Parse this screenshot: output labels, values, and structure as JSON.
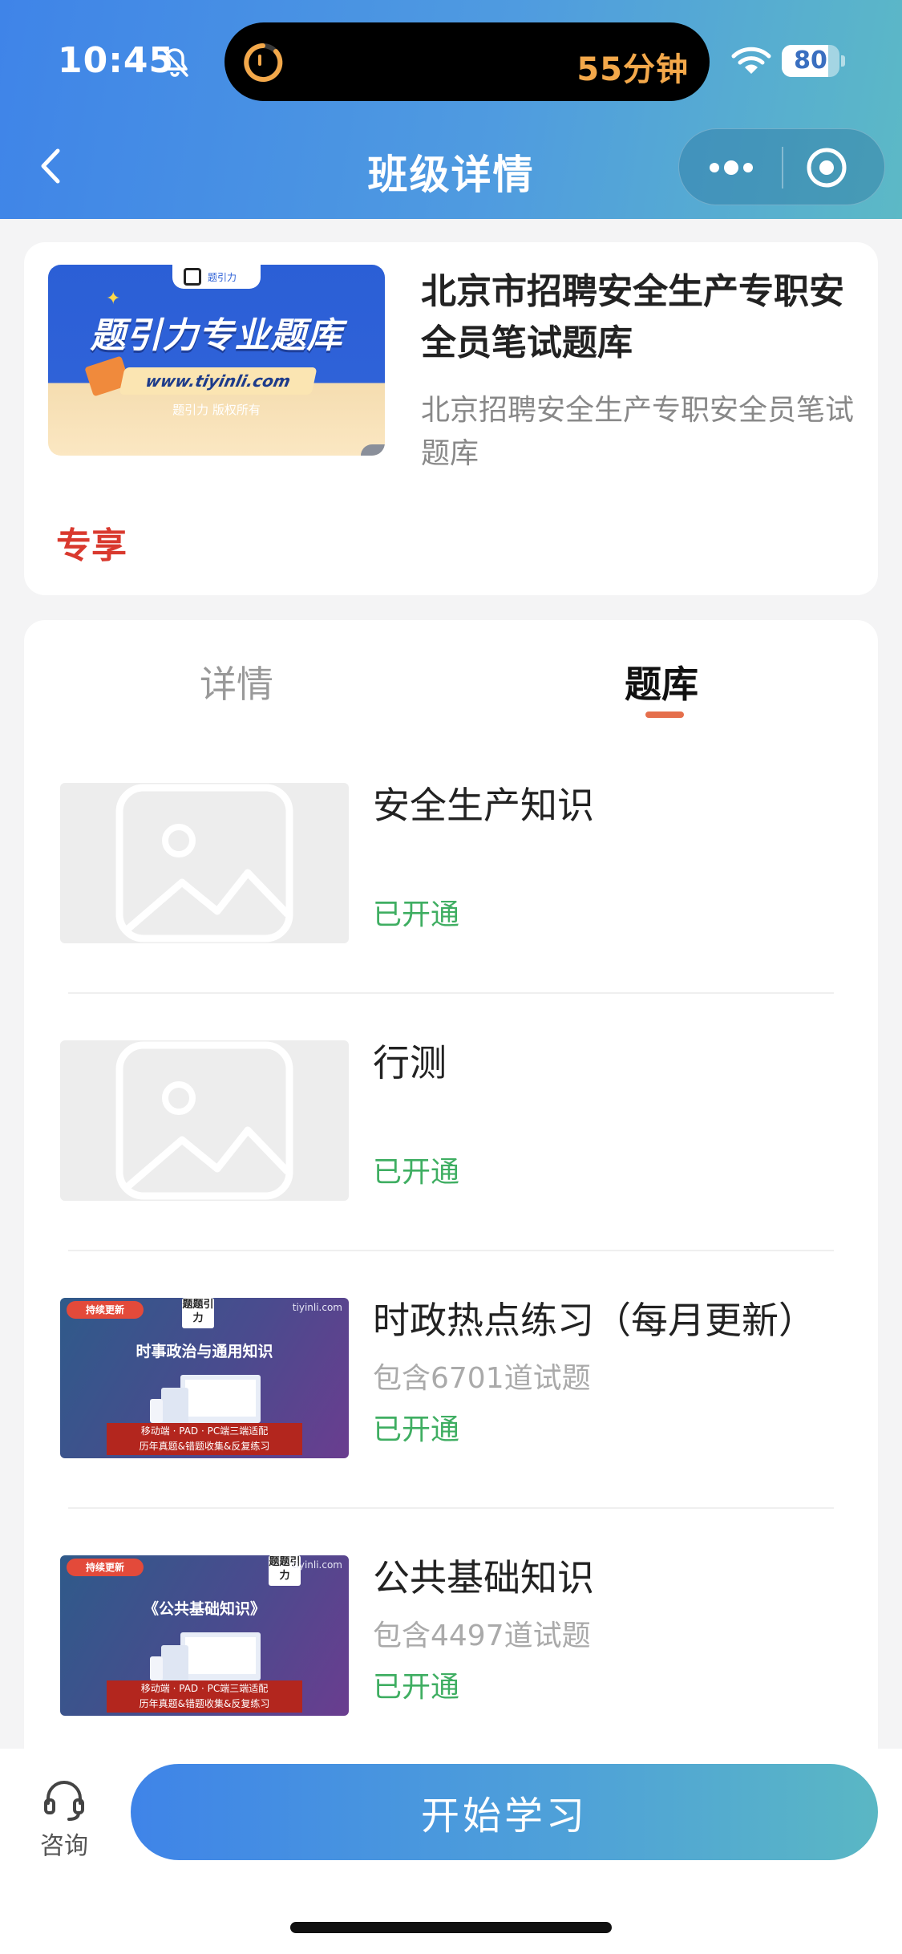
{
  "status_bar": {
    "time": "10:45",
    "island_text": "55分钟",
    "battery_level": "80",
    "battery_fraction": 0.8,
    "icons": [
      "bell-slash-icon",
      "timer-ring-icon",
      "wifi-icon",
      "battery-icon"
    ]
  },
  "nav": {
    "title": "班级详情",
    "icons": [
      "chevron-left-icon",
      "more-dots-icon",
      "target-circle-icon"
    ]
  },
  "course": {
    "cover": {
      "tab_text": "题引力",
      "title": "题引力专业题库",
      "url": "www.tiyinli.com",
      "copyright": "题引力 版权所有"
    },
    "title": "北京市招聘安全生产专职安全员笔试题库",
    "subtitle": "北京招聘安全生产专职安全员笔试题库",
    "tag": "专享"
  },
  "tabs": [
    {
      "label": "详情",
      "active": false
    },
    {
      "label": "题库",
      "active": true
    }
  ],
  "question_banks": [
    {
      "name": "安全生产知识",
      "count": "",
      "status": "已开通",
      "thumb": "placeholder"
    },
    {
      "name": "行测",
      "count": "",
      "status": "已开通",
      "thumb": "placeholder"
    },
    {
      "name": "时政热点练习（每月更新）",
      "count": "包含6701道试题",
      "status": "已开通",
      "thumb": "promo",
      "promo": {
        "badge": "持续更新",
        "logo": "题题引力",
        "site": "tiyinli.com",
        "heading": "时事政治与通用知识",
        "ribbon_line1": "移动端 · PAD · PC端三端适配",
        "ribbon_line2": "历年真题&错题收集&反复练习"
      }
    },
    {
      "name": "公共基础知识",
      "count": "包含4497道试题",
      "status": "已开通",
      "thumb": "promo",
      "promo": {
        "badge": "持续更新",
        "logo": "题题引力",
        "site": "tiyinli.com",
        "heading": "《公共基础知识》",
        "ribbon_line1": "移动端 · PAD · PC端三端适配",
        "ribbon_line2": "历年真题&错题收集&反复练习"
      }
    }
  ],
  "bottom_bar": {
    "consult_label": "咨询",
    "start_button": "开始学习"
  },
  "colors": {
    "header_gradient_start": "#3f84e8",
    "header_gradient_end": "#5cb9c6",
    "accent_tab_underline": "#e56f4c",
    "status_open": "#3fae62",
    "exclusive_tag": "#d9392e",
    "island_text": "#f3a84a"
  }
}
